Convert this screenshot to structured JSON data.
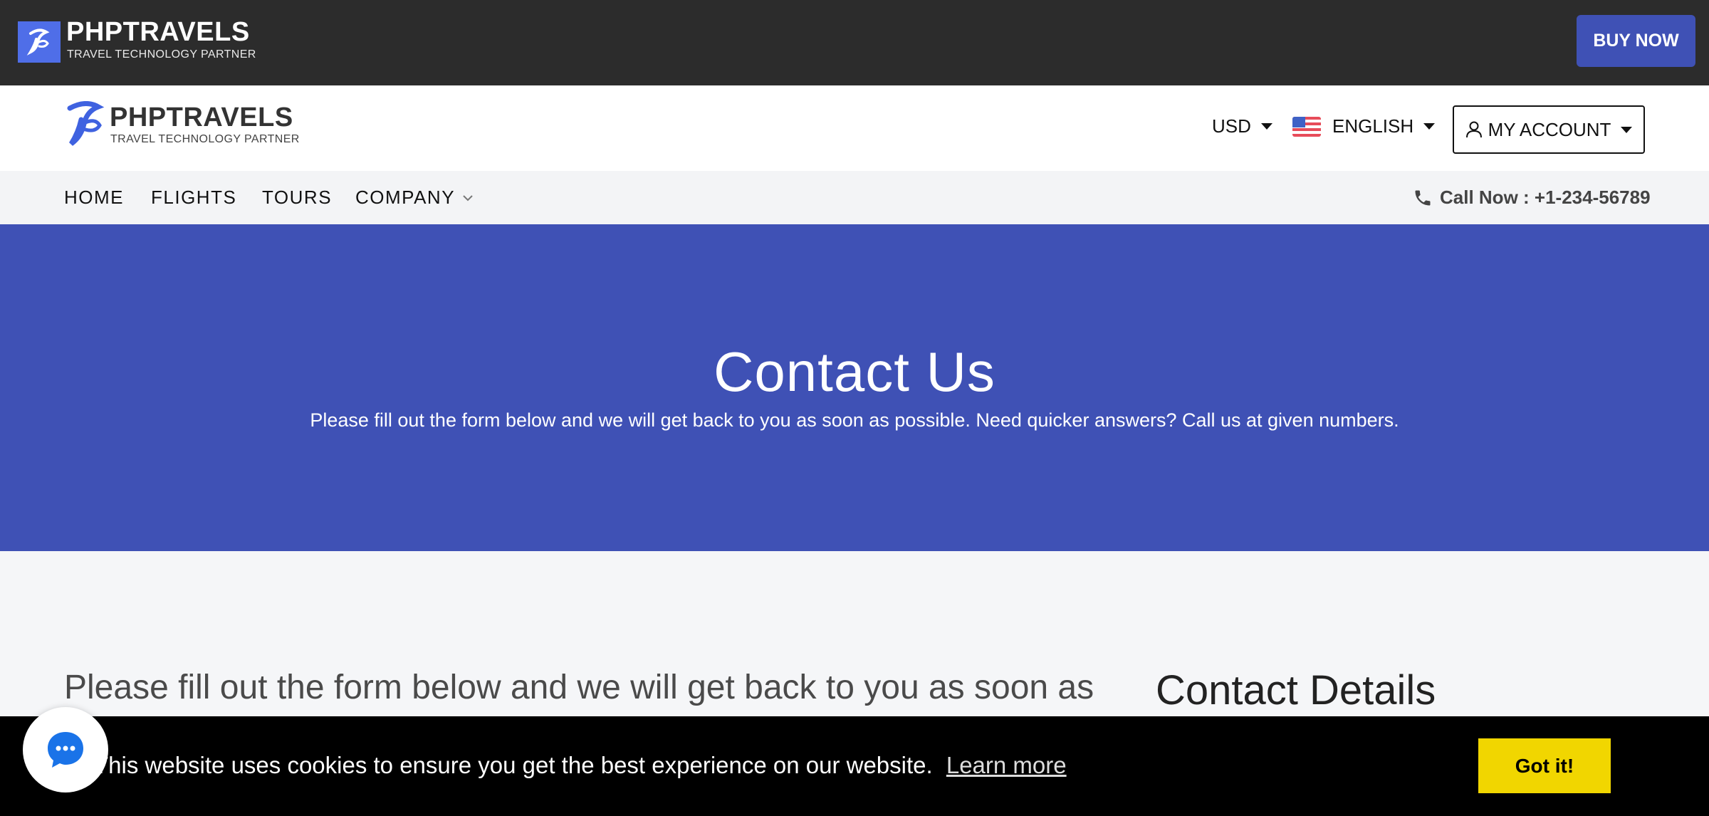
{
  "topbar": {
    "brand": "PHPTRAVELS",
    "tagline": "TRAVEL TECHNOLOGY PARTNER",
    "buy_now": "BUY NOW"
  },
  "header": {
    "brand": "PHPTRAVELS",
    "tagline": "TRAVEL TECHNOLOGY PARTNER",
    "currency": "USD",
    "language": "ENGLISH",
    "account": "MY ACCOUNT"
  },
  "nav": {
    "items": [
      "HOME",
      "FLIGHTS",
      "TOURS",
      "COMPANY"
    ],
    "call_now": "Call Now : +1-234-56789"
  },
  "hero": {
    "title": "Contact Us",
    "subtitle": "Please fill out the form below and we will get back to you as soon as possible. Need quicker answers? Call us at given numbers."
  },
  "content": {
    "lead": "Please fill out the form below and we will get back to you as soon as possible. Need quicker answers? Call us at given numbers.",
    "contact_details_title": "Contact Details"
  },
  "cookie": {
    "message": "This website uses cookies to ensure you get the best experience on our website.",
    "learn_more": "Learn more",
    "got_it": "Got it!"
  },
  "colors": {
    "primary": "#3f51b5",
    "topbar": "#2c2c2c",
    "cookie_button": "#f1d600",
    "chat_icon": "#1a73e8"
  },
  "icons": [
    "logo-icon",
    "caret-down-icon",
    "flag-us-icon",
    "user-icon",
    "chevron-down-icon",
    "phone-icon",
    "chat-icon"
  ]
}
